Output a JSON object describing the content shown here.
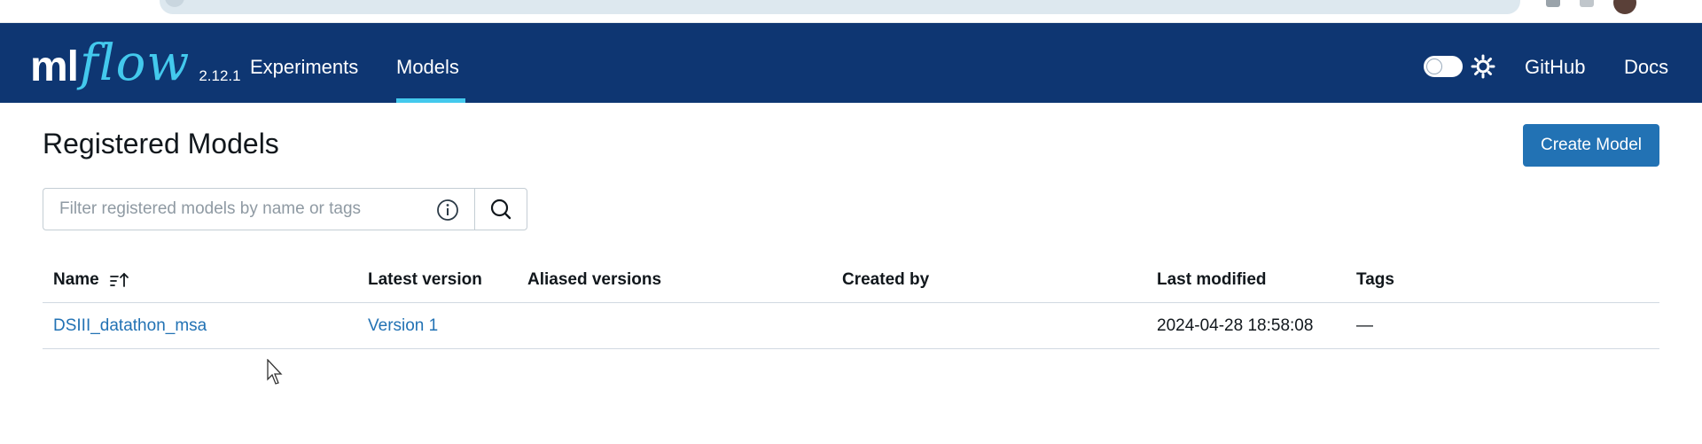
{
  "header": {
    "logo_ml": "ml",
    "logo_flow": "flow",
    "version": "2.12.1",
    "nav": [
      {
        "label": "Experiments",
        "active": false
      },
      {
        "label": "Models",
        "active": true
      }
    ],
    "right_links": [
      {
        "label": "GitHub"
      },
      {
        "label": "Docs"
      }
    ],
    "theme_toggle_icon": "sun-icon"
  },
  "page": {
    "title": "Registered Models",
    "create_button": "Create Model"
  },
  "search": {
    "placeholder": "Filter registered models by name or tags",
    "value": "",
    "info_icon": "info-icon",
    "search_icon": "search-icon"
  },
  "table": {
    "columns": [
      "Name",
      "Latest version",
      "Aliased versions",
      "Created by",
      "Last modified",
      "Tags"
    ],
    "rows": [
      {
        "name": "DSIII_datathon_msa",
        "latest_version": "Version 1",
        "aliased_versions": "",
        "created_by": "",
        "last_modified": "2024-04-28 18:58:08",
        "tags": "—"
      }
    ]
  },
  "colors": {
    "nav_bg": "#0e3672",
    "accent": "#43c9ed",
    "primary_button": "#2272b4",
    "link": "#2272b4"
  }
}
